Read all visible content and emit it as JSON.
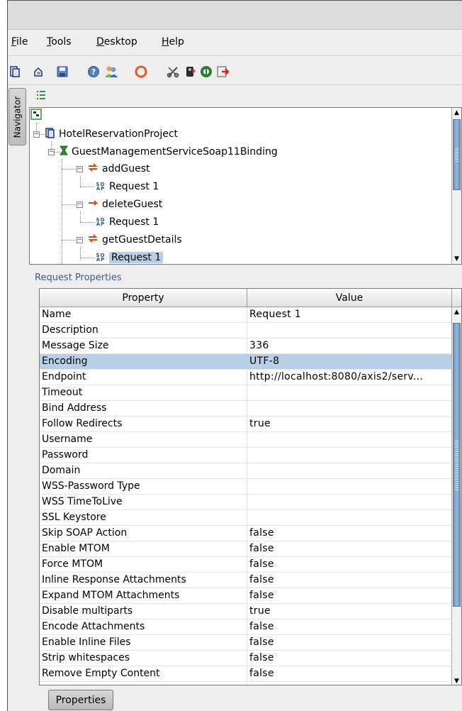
{
  "menubar": [
    {
      "label": "File",
      "mnemonic": "F",
      "rest": "ile"
    },
    {
      "label": "Tools",
      "mnemonic": "T",
      "rest": "ools"
    },
    {
      "label": "Desktop",
      "mnemonic": "D",
      "rest": "esktop"
    },
    {
      "label": "Help",
      "mnemonic": "H",
      "rest": "elp"
    }
  ],
  "toolbar": {
    "icons": [
      "new-project-icon",
      "import-project-icon",
      "save-icon",
      "preferences-icon",
      "users-icon",
      "refresh-icon",
      "tools-icon",
      "launch-icon",
      "run-icon",
      "exit-icon"
    ]
  },
  "navigator": {
    "tab_label": "Navigator",
    "tree": {
      "project": "HotelReservationProject",
      "interface": "GuestManagementServiceSoap11Binding",
      "operations": [
        {
          "name": "addGuest",
          "request": "Request 1"
        },
        {
          "name": "deleteGuest",
          "request": "Request 1"
        },
        {
          "name": "getGuestDetails",
          "request": "Request 1"
        }
      ]
    }
  },
  "properties": {
    "title": "Request Properties",
    "columns": [
      "Property",
      "Value"
    ],
    "rows": [
      {
        "property": "Name",
        "value": "Request 1"
      },
      {
        "property": "Description",
        "value": ""
      },
      {
        "property": "Message Size",
        "value": "336"
      },
      {
        "property": "Encoding",
        "value": "UTF-8"
      },
      {
        "property": "Endpoint",
        "value": "http://localhost:8080/axis2/serv..."
      },
      {
        "property": "Timeout",
        "value": ""
      },
      {
        "property": "Bind Address",
        "value": ""
      },
      {
        "property": "Follow Redirects",
        "value": "true"
      },
      {
        "property": "Username",
        "value": ""
      },
      {
        "property": "Password",
        "value": ""
      },
      {
        "property": "Domain",
        "value": ""
      },
      {
        "property": "WSS-Password Type",
        "value": ""
      },
      {
        "property": "WSS TimeToLive",
        "value": ""
      },
      {
        "property": "SSL Keystore",
        "value": ""
      },
      {
        "property": "Skip SOAP Action",
        "value": "false"
      },
      {
        "property": "Enable MTOM",
        "value": "false"
      },
      {
        "property": "Force MTOM",
        "value": "false"
      },
      {
        "property": "Inline Response Attachments",
        "value": "false"
      },
      {
        "property": "Expand MTOM Attachments",
        "value": "false"
      },
      {
        "property": "Disable multiparts",
        "value": "true"
      },
      {
        "property": "Encode Attachments",
        "value": "false"
      },
      {
        "property": "Enable Inline Files",
        "value": "false"
      },
      {
        "property": "Strip whitespaces",
        "value": "false"
      },
      {
        "property": "Remove Empty Content",
        "value": "false"
      }
    ],
    "selected_index": 3,
    "button_label": "Properties"
  },
  "colors": {
    "selection": "#b8cfe5",
    "scroll_thumb": "#7fa3cc",
    "title_blue": "#3a5b8c"
  }
}
